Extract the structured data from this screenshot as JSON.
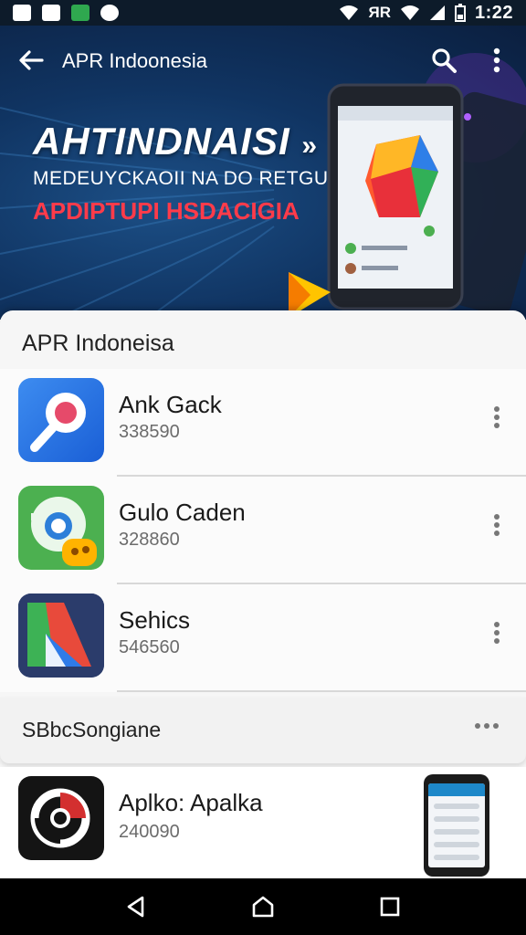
{
  "status_bar": {
    "time": "1:22",
    "network_label": "ЯR",
    "icons": [
      "notification-icon",
      "notification-icon",
      "gallery-icon",
      "app-icon",
      "wifi-icon",
      "signal-icon",
      "battery-icon"
    ]
  },
  "header": {
    "title": "APR Indoonesia"
  },
  "hero": {
    "headline": "AHTINDNAISI",
    "subtitle": "MEDEUYCKAOII NA DO RETGUEN",
    "tagline": "APDIPTUPI HSDACIGIA",
    "colors": {
      "tagline": "#ff3b4a",
      "background": "#103462"
    }
  },
  "section_1": {
    "title": "APR Indoneisa",
    "items": [
      {
        "name": "Ank Gack",
        "number": "338590",
        "icon": "search-app-icon"
      },
      {
        "name": "Gulo Caden",
        "number": "328860",
        "icon": "chat-app-icon"
      },
      {
        "name": "Sehics",
        "number": "546560",
        "icon": "play-app-icon"
      }
    ]
  },
  "section_2": {
    "title": "SBbcSongiane",
    "items": [
      {
        "name": "Aplko: Apalka",
        "number": "240090",
        "icon": "media-app-icon"
      }
    ]
  },
  "nav": {
    "buttons": [
      "back-icon",
      "home-icon",
      "recents-icon"
    ]
  }
}
